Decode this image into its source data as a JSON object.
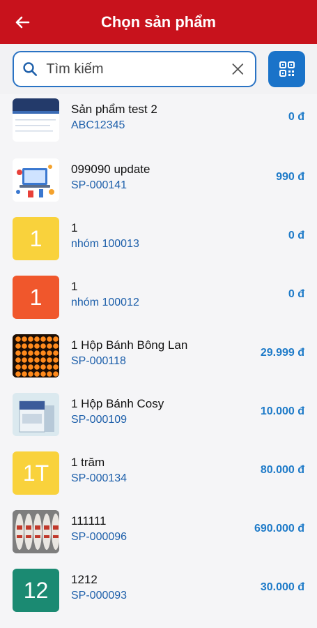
{
  "header": {
    "title": "Chọn sản phẩm",
    "back_icon": "arrow-left-icon"
  },
  "search": {
    "placeholder": "Tìm kiếm",
    "value": "",
    "qr_icon": "qr-code-icon"
  },
  "colors": {
    "brand": "#c8121c",
    "accent": "#1a73c9",
    "code": "#1d5faa",
    "price": "#1d7ac8"
  },
  "products": [
    {
      "name": " Sản phẩm test 2",
      "code": "ABC12345",
      "price": "0 đ",
      "thumb_text": "",
      "thumb_type": "image-document",
      "thumb_color": "#ffffff"
    },
    {
      "name": "099090 update",
      "code": "SP-000141",
      "price": "990 đ",
      "thumb_text": "",
      "thumb_type": "image-illustration",
      "thumb_color": "#ffffff"
    },
    {
      "name": "1",
      "code": "nhóm 100013",
      "price": "0 đ",
      "thumb_text": "1",
      "thumb_type": "text",
      "thumb_color": "#f9d23c"
    },
    {
      "name": "1",
      "code": "nhóm 100012",
      "price": "0 đ",
      "thumb_text": "1",
      "thumb_type": "text",
      "thumb_color": "#f0572c"
    },
    {
      "name": "1 Hộp Bánh Bông Lan",
      "code": "SP-000118",
      "price": "29.999 đ",
      "thumb_text": "",
      "thumb_type": "image-lights",
      "thumb_color": "#2a1608"
    },
    {
      "name": "1 Hộp Bánh Cosy",
      "code": "SP-000109",
      "price": "10.000 đ",
      "thumb_text": "",
      "thumb_type": "image-box",
      "thumb_color": "#d6e6ec"
    },
    {
      "name": "1 trăm",
      "code": "SP-000134",
      "price": "80.000 đ",
      "thumb_text": "1T",
      "thumb_type": "text",
      "thumb_color": "#f9d23c"
    },
    {
      "name": "111111",
      "code": "SP-000096",
      "price": "690.000 đ",
      "thumb_text": "",
      "thumb_type": "image-cans",
      "thumb_color": "#8a8a8a"
    },
    {
      "name": "1212",
      "code": "SP-000093",
      "price": "30.000 đ",
      "thumb_text": "12",
      "thumb_type": "text",
      "thumb_color": "#1b8a72"
    }
  ]
}
